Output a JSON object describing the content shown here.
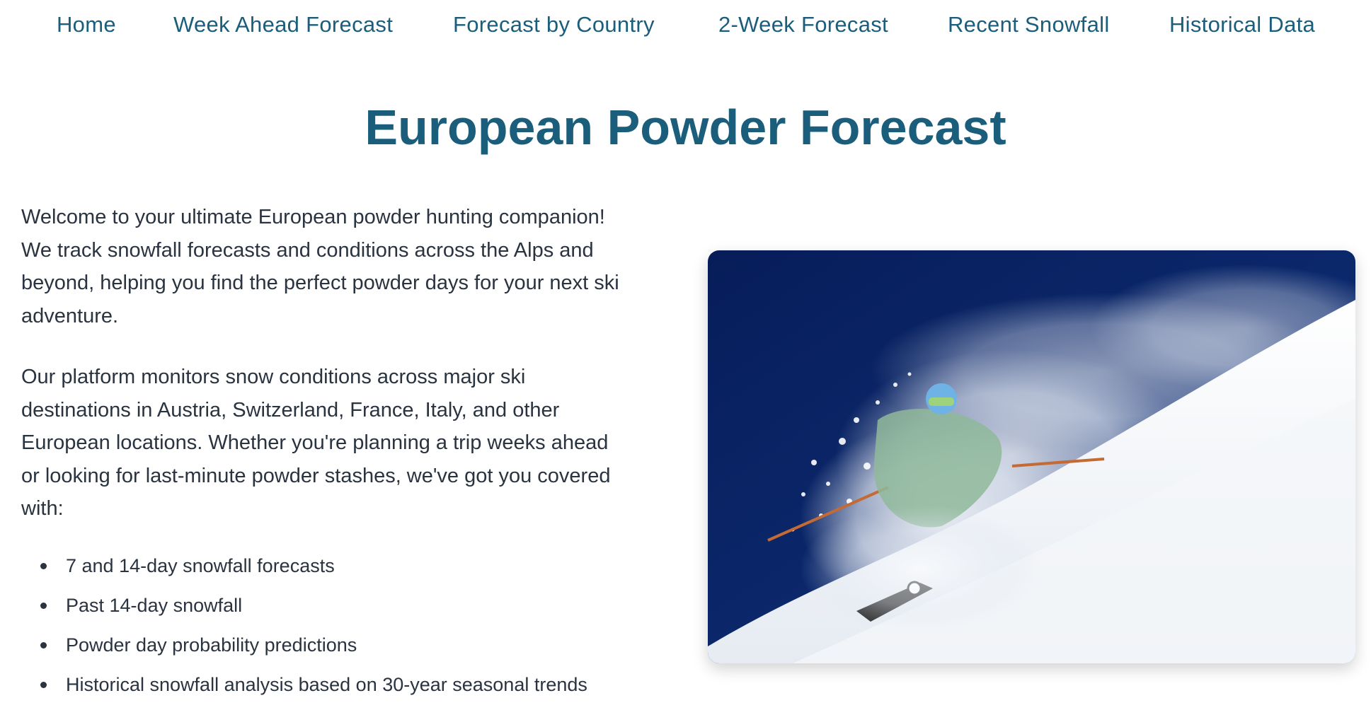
{
  "nav": {
    "items": [
      {
        "label": "Home"
      },
      {
        "label": "Week Ahead Forecast"
      },
      {
        "label": "Forecast by Country"
      },
      {
        "label": "2-Week Forecast"
      },
      {
        "label": "Recent Snowfall"
      },
      {
        "label": "Historical Data"
      }
    ]
  },
  "page": {
    "title": "European Powder Forecast"
  },
  "intro": {
    "paragraph1": "Welcome to your ultimate European powder hunting companion! We track snowfall forecasts and conditions across the Alps and beyond, helping you find the perfect powder days for your next ski adventure.",
    "paragraph2": "Our platform monitors snow conditions across major ski destinations in Austria, Switzerland, France, Italy, and other European locations. Whether you're planning a trip weeks ahead or looking for last-minute powder stashes, we've got you covered with:"
  },
  "features": [
    "7 and 14-day snowfall forecasts",
    "Past 14-day snowfall",
    "Powder day probability predictions",
    "Historical snowfall analysis based on 30-year seasonal trends"
  ],
  "hero_image": {
    "subject": "skier in deep powder snow",
    "colors": {
      "sky": "#0c2a6e",
      "snow": "#f4f6f9",
      "jacket": "#8fb89a",
      "helmet": "#6fb3e6",
      "pole": "#c46a35"
    }
  },
  "colors": {
    "accent": "#1b5e7b",
    "text": "#2a3340",
    "background": "#ffffff"
  }
}
